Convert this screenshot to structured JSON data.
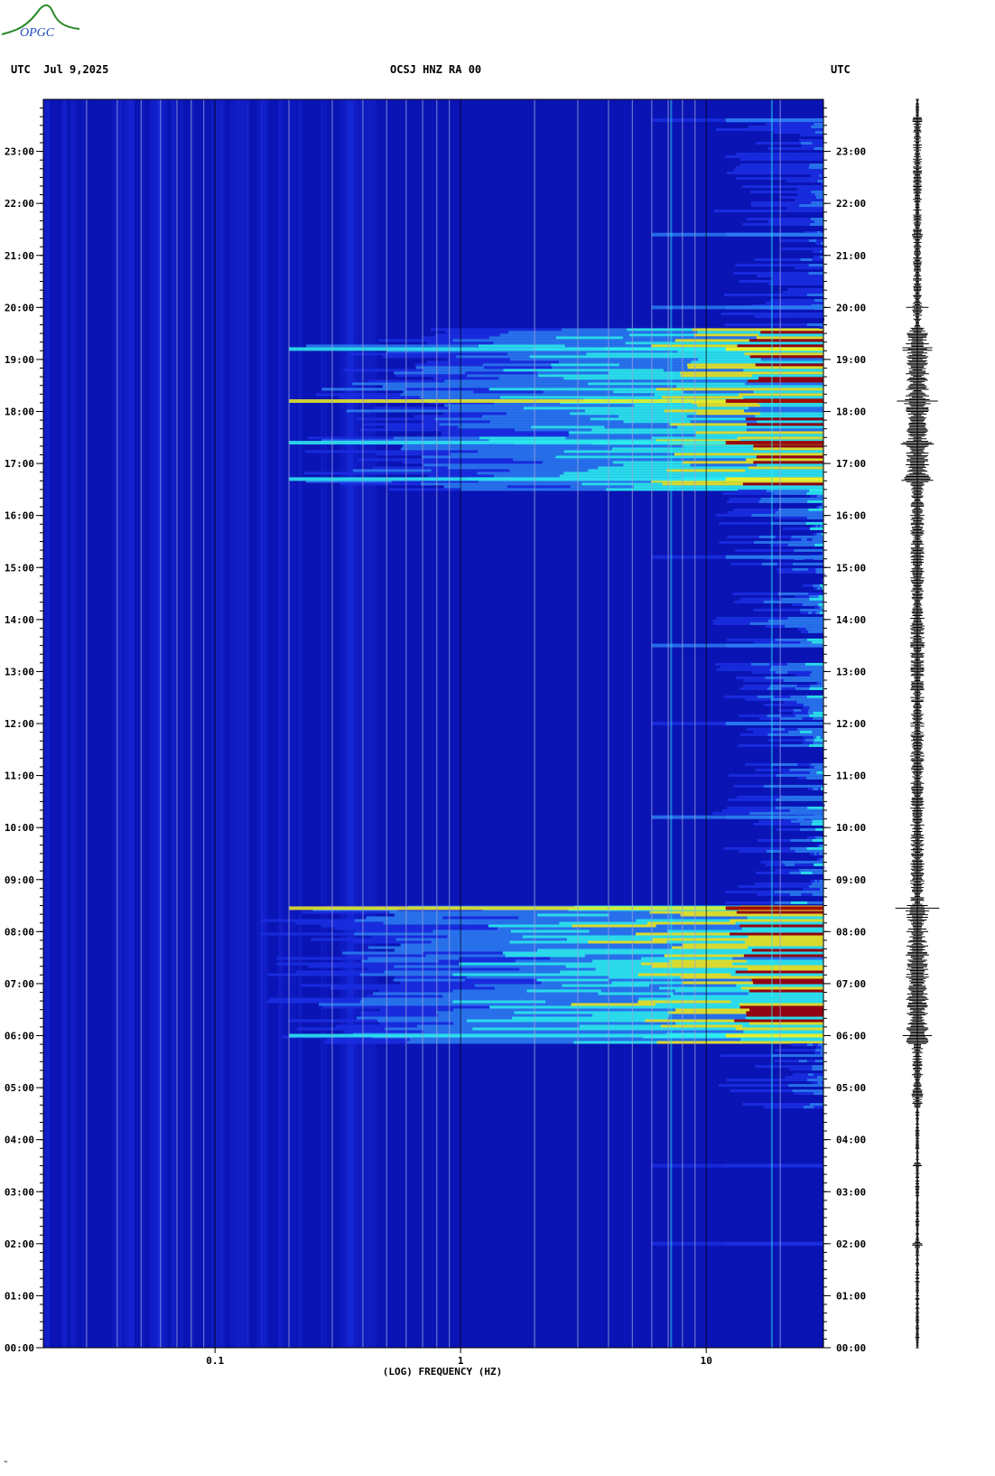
{
  "header": {
    "left": "UTC  Jul 9,2025",
    "center": "OCSJ HNZ RA 00",
    "right": "UTC"
  },
  "logo": {
    "text": "OPGC"
  },
  "corner_mark": "\"",
  "colors": {
    "background": "#0a14b4",
    "low": "#1a2ee0",
    "cyan": "#2ef0f0",
    "yellow": "#f0f020",
    "red": "#a00000",
    "logo_green": "#2a8a2a",
    "logo_blue": "#2050c0"
  },
  "chart_data": {
    "type": "heatmap",
    "xlabel": "(LOG) FREQUENCY (HZ)",
    "ylabel": "",
    "xscale": "log",
    "xlim": [
      0.02,
      30
    ],
    "x_ticks": [
      {
        "value": 0.1,
        "label": "0.1"
      },
      {
        "value": 1,
        "label": "1"
      },
      {
        "value": 10,
        "label": "10"
      }
    ],
    "ylim": [
      0,
      24
    ],
    "y_ticks": [
      {
        "value": 0,
        "label": "00:00"
      },
      {
        "value": 1,
        "label": "01:00"
      },
      {
        "value": 2,
        "label": "02:00"
      },
      {
        "value": 3,
        "label": "03:00"
      },
      {
        "value": 4,
        "label": "04:00"
      },
      {
        "value": 5,
        "label": "05:00"
      },
      {
        "value": 6,
        "label": "06:00"
      },
      {
        "value": 7,
        "label": "07:00"
      },
      {
        "value": 8,
        "label": "08:00"
      },
      {
        "value": 9,
        "label": "09:00"
      },
      {
        "value": 10,
        "label": "10:00"
      },
      {
        "value": 11,
        "label": "11:00"
      },
      {
        "value": 12,
        "label": "12:00"
      },
      {
        "value": 13,
        "label": "13:00"
      },
      {
        "value": 14,
        "label": "14:00"
      },
      {
        "value": 15,
        "label": "15:00"
      },
      {
        "value": 16,
        "label": "16:00"
      },
      {
        "value": 17,
        "label": "17:00"
      },
      {
        "value": 18,
        "label": "18:00"
      },
      {
        "value": 19,
        "label": "19:00"
      },
      {
        "value": 20,
        "label": "20:00"
      },
      {
        "value": 21,
        "label": "21:00"
      },
      {
        "value": 22,
        "label": "22:00"
      },
      {
        "value": 23,
        "label": "23:00"
      }
    ],
    "grid": true,
    "high_energy_bands": [
      {
        "t_start": 5.85,
        "t_end": 8.5,
        "f_start": 0.2,
        "level": 0.9
      },
      {
        "t_start": 16.5,
        "t_end": 19.6,
        "f_start": 0.3,
        "level": 0.9
      },
      {
        "t_start": 8.5,
        "t_end": 16.5,
        "f_start": 14,
        "level": 0.55
      },
      {
        "t_start": 19.6,
        "t_end": 23.6,
        "f_start": 14,
        "level": 0.35
      },
      {
        "t_start": 4.6,
        "t_end": 5.85,
        "f_start": 14,
        "level": 0.45
      }
    ],
    "events": [
      {
        "t": 8.45,
        "level": 1.0
      },
      {
        "t": 18.2,
        "level": 1.0
      },
      {
        "t": 17.4,
        "level": 0.9
      },
      {
        "t": 16.7,
        "level": 0.85
      },
      {
        "t": 19.2,
        "level": 0.85
      },
      {
        "t": 6.0,
        "level": 0.8
      },
      {
        "t": 20.0,
        "level": 0.5
      },
      {
        "t": 21.4,
        "level": 0.45
      },
      {
        "t": 23.6,
        "level": 0.35
      },
      {
        "t": 2.0,
        "level": 0.3
      },
      {
        "t": 3.5,
        "level": 0.25
      },
      {
        "t": 15.2,
        "level": 0.35
      },
      {
        "t": 13.5,
        "level": 0.4
      },
      {
        "t": 10.2,
        "level": 0.4
      },
      {
        "t": 12.0,
        "level": 0.35
      }
    ]
  }
}
